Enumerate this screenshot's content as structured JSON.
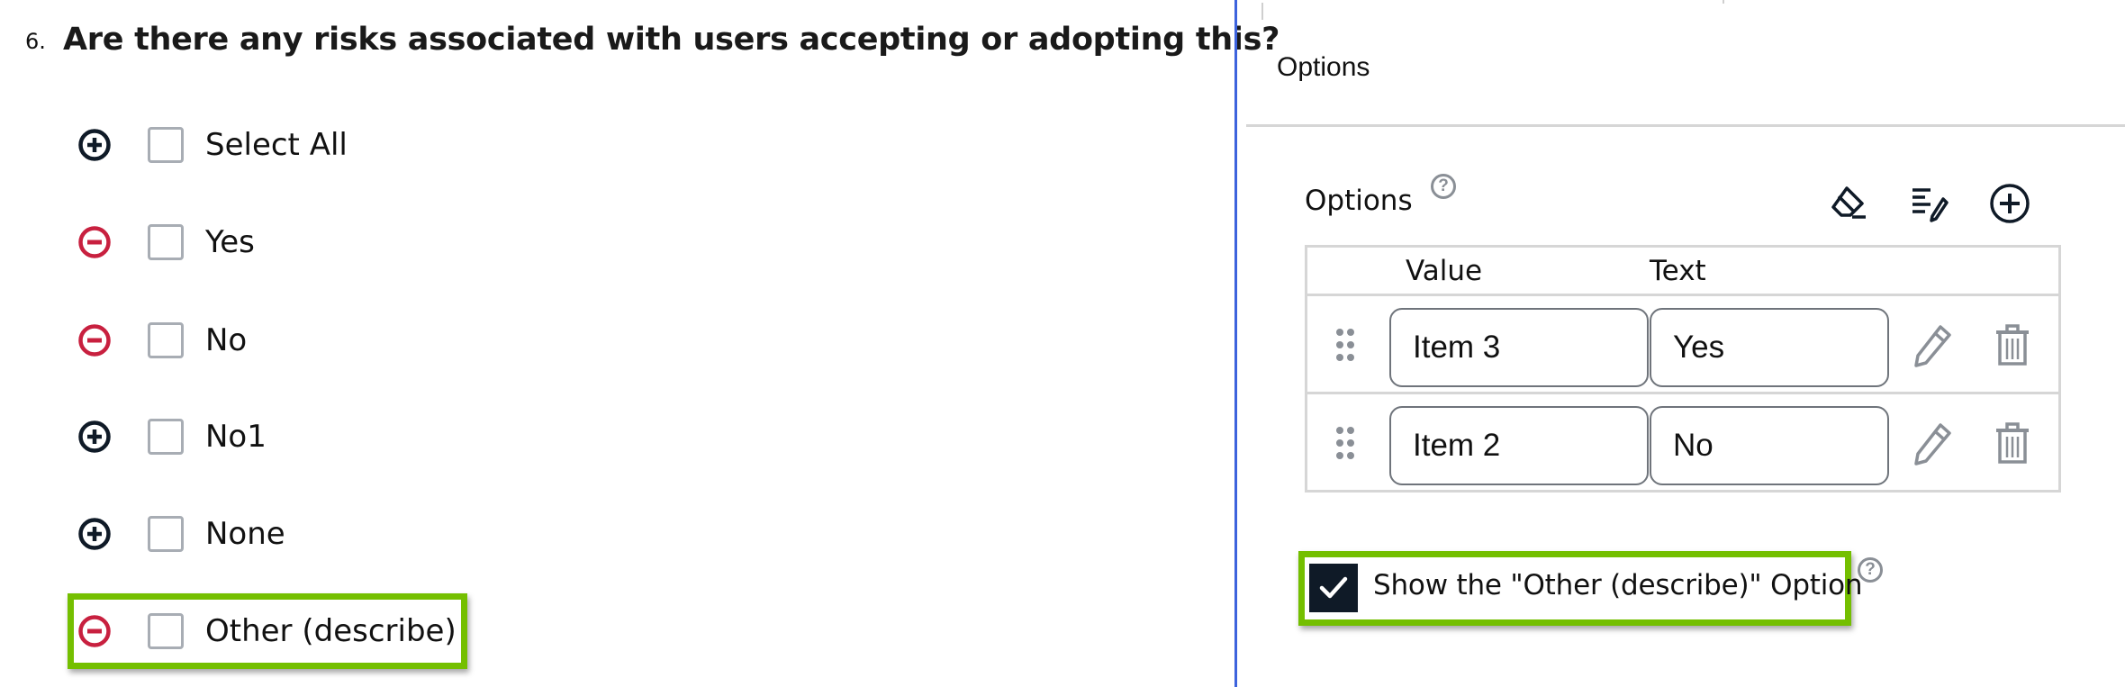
{
  "question": {
    "number": "6.",
    "title": "Are there any risks associated with users accepting or adopting this?",
    "choices": [
      {
        "label": "Select All",
        "toggle": "add",
        "checked": false
      },
      {
        "label": "Yes",
        "toggle": "remove",
        "checked": false
      },
      {
        "label": "No",
        "toggle": "remove",
        "checked": false
      },
      {
        "label": "No1",
        "toggle": "add",
        "checked": false
      },
      {
        "label": "None",
        "toggle": "add",
        "checked": false
      },
      {
        "label": "Other (describe)",
        "toggle": "remove",
        "checked": false,
        "highlighted": true
      }
    ]
  },
  "panel": {
    "section_title": "Options",
    "options_label": "Options",
    "help_glyph": "?",
    "toolbar": {
      "clear_icon": "eraser-icon",
      "edit_icon": "list-edit-icon",
      "add_icon": "plus-circle-icon"
    },
    "table": {
      "headers": {
        "value": "Value",
        "text": "Text"
      },
      "rows": [
        {
          "value": "Item 3",
          "text": "Yes"
        },
        {
          "value": "Item 2",
          "text": "No"
        }
      ]
    },
    "show_other": {
      "label": "Show the \"Other (describe)\" Option",
      "checked": true,
      "highlighted": true
    }
  },
  "colors": {
    "highlight": "#74bf00",
    "remove_icon": "#c8203f",
    "add_icon": "#0f1a27",
    "divider": "#3d63dd",
    "checkbox_checked": "#0f1a27"
  }
}
